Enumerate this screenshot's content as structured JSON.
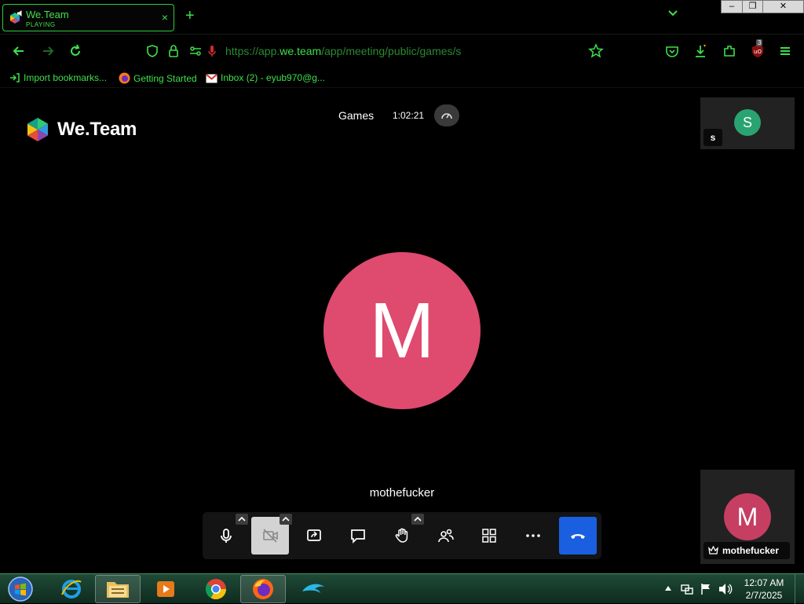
{
  "browser": {
    "tab": {
      "title": "We.Team",
      "status": "PLAYING",
      "close": "×"
    },
    "new_tab": "+",
    "window": {
      "min": "–",
      "max": "❐",
      "close": "✕"
    },
    "url": {
      "prefix": "https://app.",
      "host": "we.team",
      "path": "/app/meeting/public/games/s"
    },
    "bookmarks": [
      {
        "label": "Import bookmarks...",
        "icon": "import-icon"
      },
      {
        "label": "Getting Started",
        "icon": "firefox-icon"
      },
      {
        "label": "Inbox (2) - eyub970@g...",
        "icon": "gmail-icon"
      }
    ],
    "ublock_badge": "3",
    "accent": "#3ee04a"
  },
  "meeting": {
    "logo_text": "We.Team",
    "room_name": "Games",
    "timer": "1:02:21",
    "main_participant": {
      "initial": "M",
      "name": "mothefucker",
      "color": "#df4a6f"
    },
    "thumbnails": [
      {
        "initial": "S",
        "label": "s",
        "color": "#2aa372"
      },
      {
        "initial": "M",
        "label": "mothefucker",
        "color": "#c63e62"
      }
    ],
    "toolbar": {
      "buttons": [
        "microphone",
        "camera-off",
        "screen-share",
        "chat",
        "raise-hand",
        "participants",
        "tile-view",
        "more",
        "hang-up"
      ],
      "hangup_color": "#1a5fe0"
    }
  },
  "taskbar": {
    "apps": [
      "internet-explorer",
      "file-explorer",
      "media-player",
      "chrome",
      "firefox",
      "dolphin"
    ],
    "clock": {
      "time": "12:07 AM",
      "date": "2/7/2025"
    }
  }
}
